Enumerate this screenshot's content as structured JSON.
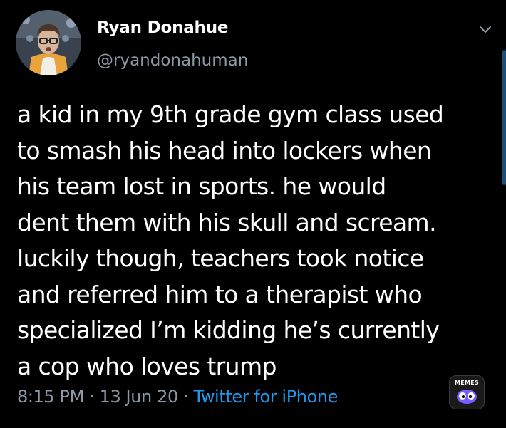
{
  "user": {
    "display_name": "Ryan Donahue",
    "handle": "@ryandonahuman"
  },
  "tweet": {
    "text": "a kid in my 9th grade gym class used\nto smash his head into lockers when\nhis team lost in sports. he would\ndent them with his skull and scream.\nluckily though, teachers took notice\nand referred him to a therapist who\nspecialized I’m kidding he’s currently\na cop who loves trump",
    "time": "8:15 PM",
    "separator": " · ",
    "date": "13 Jun 20",
    "source": "Twitter for iPhone"
  },
  "watermark": {
    "label": "MEMES"
  },
  "colors": {
    "background": "#000000",
    "text": "#ffffff",
    "secondary": "#8b98a5",
    "link": "#1d9bf0"
  },
  "icons": {
    "caret": "chevron-down-icon",
    "watermark": "memes-logo-icon"
  }
}
